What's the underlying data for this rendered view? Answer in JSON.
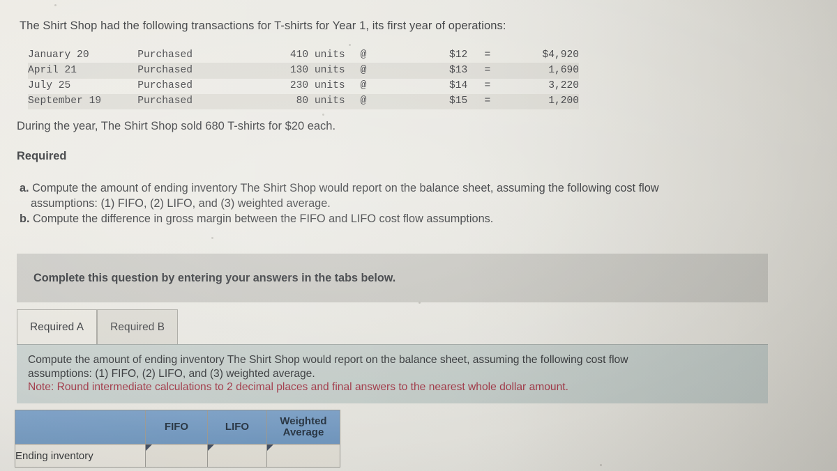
{
  "intro": {
    "text": "The Shirt Shop had the following transactions for T-shirts for Year 1, its first year of operations:"
  },
  "transactions": {
    "rows": [
      {
        "date": "January 20",
        "action": "Purchased",
        "units": "410 units",
        "at": "@",
        "cost": "$12",
        "eq": "=",
        "total": "$4,920"
      },
      {
        "date": "April 21",
        "action": "Purchased",
        "units": "130 units",
        "at": "@",
        "cost": "$13",
        "eq": "=",
        "total": "1,690"
      },
      {
        "date": "July 25",
        "action": "Purchased",
        "units": "230 units",
        "at": "@",
        "cost": "$14",
        "eq": "=",
        "total": "3,220"
      },
      {
        "date": "September 19",
        "action": "Purchased",
        "units": "80 units",
        "at": "@",
        "cost": "$15",
        "eq": "=",
        "total": "1,200"
      }
    ]
  },
  "sold_line": "During the year, The Shirt Shop sold 680 T-shirts for $20 each.",
  "required": {
    "heading": "Required",
    "item_a_label": "a.",
    "item_a_line1": "Compute the amount of ending inventory The Shirt Shop would report on the balance sheet, assuming the following cost flow",
    "item_a_line2": "assumptions: (1) FIFO, (2) LIFO, and (3) weighted average.",
    "item_b_label": "b.",
    "item_b_text": "Compute the difference in gross margin between the FIFO and LIFO cost flow assumptions."
  },
  "banner": {
    "text": "Complete this question by entering your answers in the tabs below."
  },
  "tabs": {
    "items": [
      {
        "label": "Required A",
        "active": true
      },
      {
        "label": "Required B",
        "active": false
      }
    ]
  },
  "instruction_panel": {
    "line1": "Compute the amount of ending inventory The Shirt Shop would report on the balance sheet, assuming the following cost flow",
    "line2": "assumptions: (1) FIFO, (2) LIFO, and (3) weighted average.",
    "note": "Note: Round intermediate calculations to 2 decimal places and final answers to the nearest whole dollar amount.",
    "note_color": "#a03242"
  },
  "answer_table": {
    "headers": {
      "blank": "",
      "fifo": "FIFO",
      "lifo": "LIFO",
      "weighted_average": "Weighted Average"
    },
    "rows": [
      {
        "label": "Ending inventory",
        "fifo_value": "",
        "lifo_value": "",
        "weighted_average_value": ""
      }
    ]
  },
  "colors": {
    "page_background": "#e8e7e1",
    "banner_grey": "#c8c7c2",
    "instruction_blue_grey": "#c5cecb",
    "table_header_blue": "#7099c4",
    "input_border": "#5f6f87",
    "note_red": "#a03242"
  }
}
